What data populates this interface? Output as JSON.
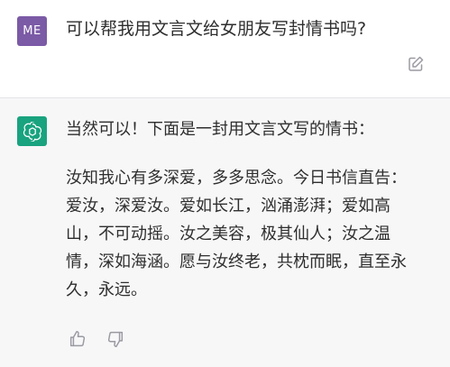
{
  "user": {
    "avatar_text": "ME",
    "message": "可以帮我用文言文给女朋友写封情书吗?"
  },
  "assistant": {
    "intro": "当然可以！下面是一封用文言文写的情书：",
    "body_lines": [
      "汝知我心有多深爱，多多思念。今日书信直告：",
      "爱汝，深爱汝。爱如长江，汹涌澎湃；爱如高",
      "山，不可动摇。汝之美容，极其仙人；汝之温",
      "情，深如海涵。愿与汝终老，共枕而眠，直至永",
      "久，永远。"
    ]
  },
  "icons": {
    "edit": "edit-icon",
    "logo": "openai-logo-icon",
    "thumbs_up": "thumbs-up-icon",
    "thumbs_down": "thumbs-down-icon"
  },
  "colors": {
    "user_avatar": "#7b5aa6",
    "assistant_avatar": "#19a37f",
    "assistant_bg": "#f7f7f8",
    "text": "#2e2e2e",
    "icon": "#9a9aa3"
  }
}
